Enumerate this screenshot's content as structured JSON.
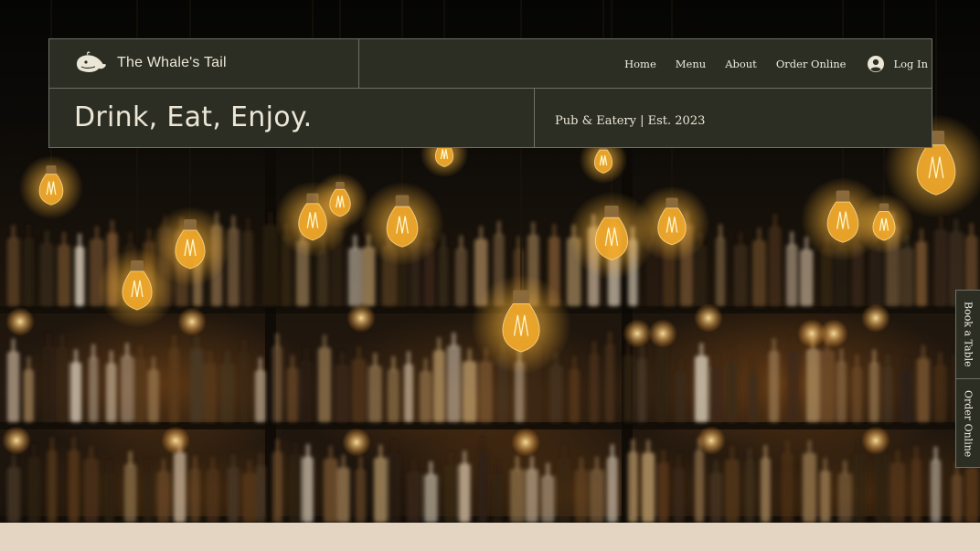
{
  "brand": {
    "name": "The Whale's Tail",
    "logo_icon": "whale-icon"
  },
  "nav": {
    "items": [
      "Home",
      "Menu",
      "About",
      "Order Online"
    ],
    "login_label": "Log In",
    "login_icon": "user-avatar-icon"
  },
  "hero": {
    "headline": "Drink, Eat, Enjoy.",
    "tagline": "Pub & Eatery | Est. 2023"
  },
  "side_tabs": [
    "Book a Table",
    "Order Online"
  ],
  "colors": {
    "panel": "#2c2e23",
    "panel_border": "#6e7166",
    "text": "#ece6d6",
    "strip": "#e3d5c1",
    "bulb_glow": "#ffb83a"
  }
}
